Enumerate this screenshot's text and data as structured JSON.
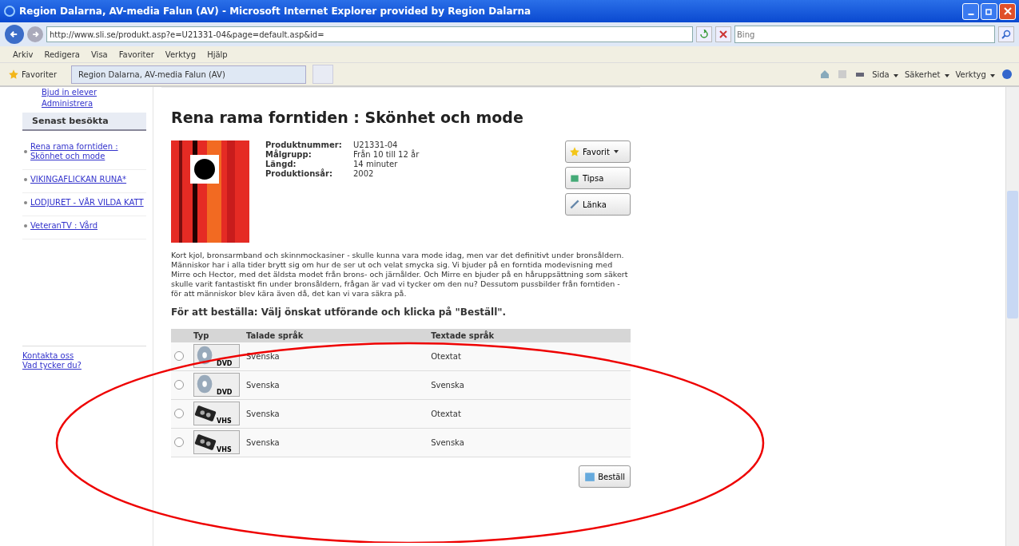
{
  "window": {
    "title": "Region Dalarna, AV-media Falun (AV) - Microsoft Internet Explorer provided by Region Dalarna"
  },
  "address_bar": {
    "value": "http://www.sli.se/produkt.asp?e=U21331-04&page=default.asp&id=",
    "search_placeholder": "Bing"
  },
  "menu": [
    "Arkiv",
    "Redigera",
    "Visa",
    "Favoriter",
    "Verktyg",
    "Hjälp"
  ],
  "favorites_bar": {
    "label": "Favoriter",
    "tab": "Region Dalarna, AV-media Falun (AV)",
    "tools": [
      "Sida",
      "Säkerhet",
      "Verktyg"
    ]
  },
  "sidebar": {
    "links": [
      "Bjud in elever",
      "Administrera"
    ],
    "section_title": "Senast besökta",
    "recent": [
      "Rena rama forntiden : Skönhet och mode",
      "VIKINGAFLICKAN RUNA*",
      "LODJURET - VÅR VILDA KATT",
      "VeteranTV : Vård"
    ],
    "footer_links": [
      "Kontakta oss",
      "Vad tycker du?"
    ]
  },
  "product": {
    "title": "Rena rama forntiden : Skönhet och mode",
    "facts": [
      {
        "label": "Produktnummer:",
        "value": "U21331-04"
      },
      {
        "label": "Målgrupp:",
        "value": "Från 10 till 12 år"
      },
      {
        "label": "Längd:",
        "value": "14 minuter"
      },
      {
        "label": "Produktionsår:",
        "value": "2002"
      }
    ],
    "actions": [
      {
        "kind": "star",
        "label": "Favorit"
      },
      {
        "kind": "tip",
        "label": "Tipsa"
      },
      {
        "kind": "link",
        "label": "Länka"
      }
    ],
    "description": "Kort kjol, bronsarmband och skinnmockasiner - skulle kunna vara mode idag, men var det definitivt under bronsåldern. Människor har i alla tider brytt sig om hur de ser ut och velat smycka sig. Vi bjuder på en forntida modevisning med Mirre och Hector, med det äldsta modet från brons- och järnålder. Och Mirre en bjuder på en håruppsättning som säkert skulle varit fantastiskt fin under bronsåldern, frågan är vad vi tycker om den nu? Dessutom pussbilder från forntiden - för att människor blev kära även då, det kan vi vara säkra på.",
    "order_instruction": "För att beställa: Välj önskat utförande och klicka på \"Beställ\"."
  },
  "table": {
    "columns": [
      "Typ",
      "Talade språk",
      "Textade språk"
    ],
    "rows": [
      {
        "selected": false,
        "kind": "dvd",
        "type_label": "DVD",
        "spoken": "Svenska",
        "subtitles": "Otextat"
      },
      {
        "selected": false,
        "kind": "dvd",
        "type_label": "DVD",
        "spoken": "Svenska",
        "subtitles": "Svenska"
      },
      {
        "selected": false,
        "kind": "vhs",
        "type_label": "VHS",
        "spoken": "Svenska",
        "subtitles": "Otextat"
      },
      {
        "selected": false,
        "kind": "vhs",
        "type_label": "VHS",
        "spoken": "Svenska",
        "subtitles": "Svenska"
      }
    ]
  },
  "order_button": "Beställ"
}
